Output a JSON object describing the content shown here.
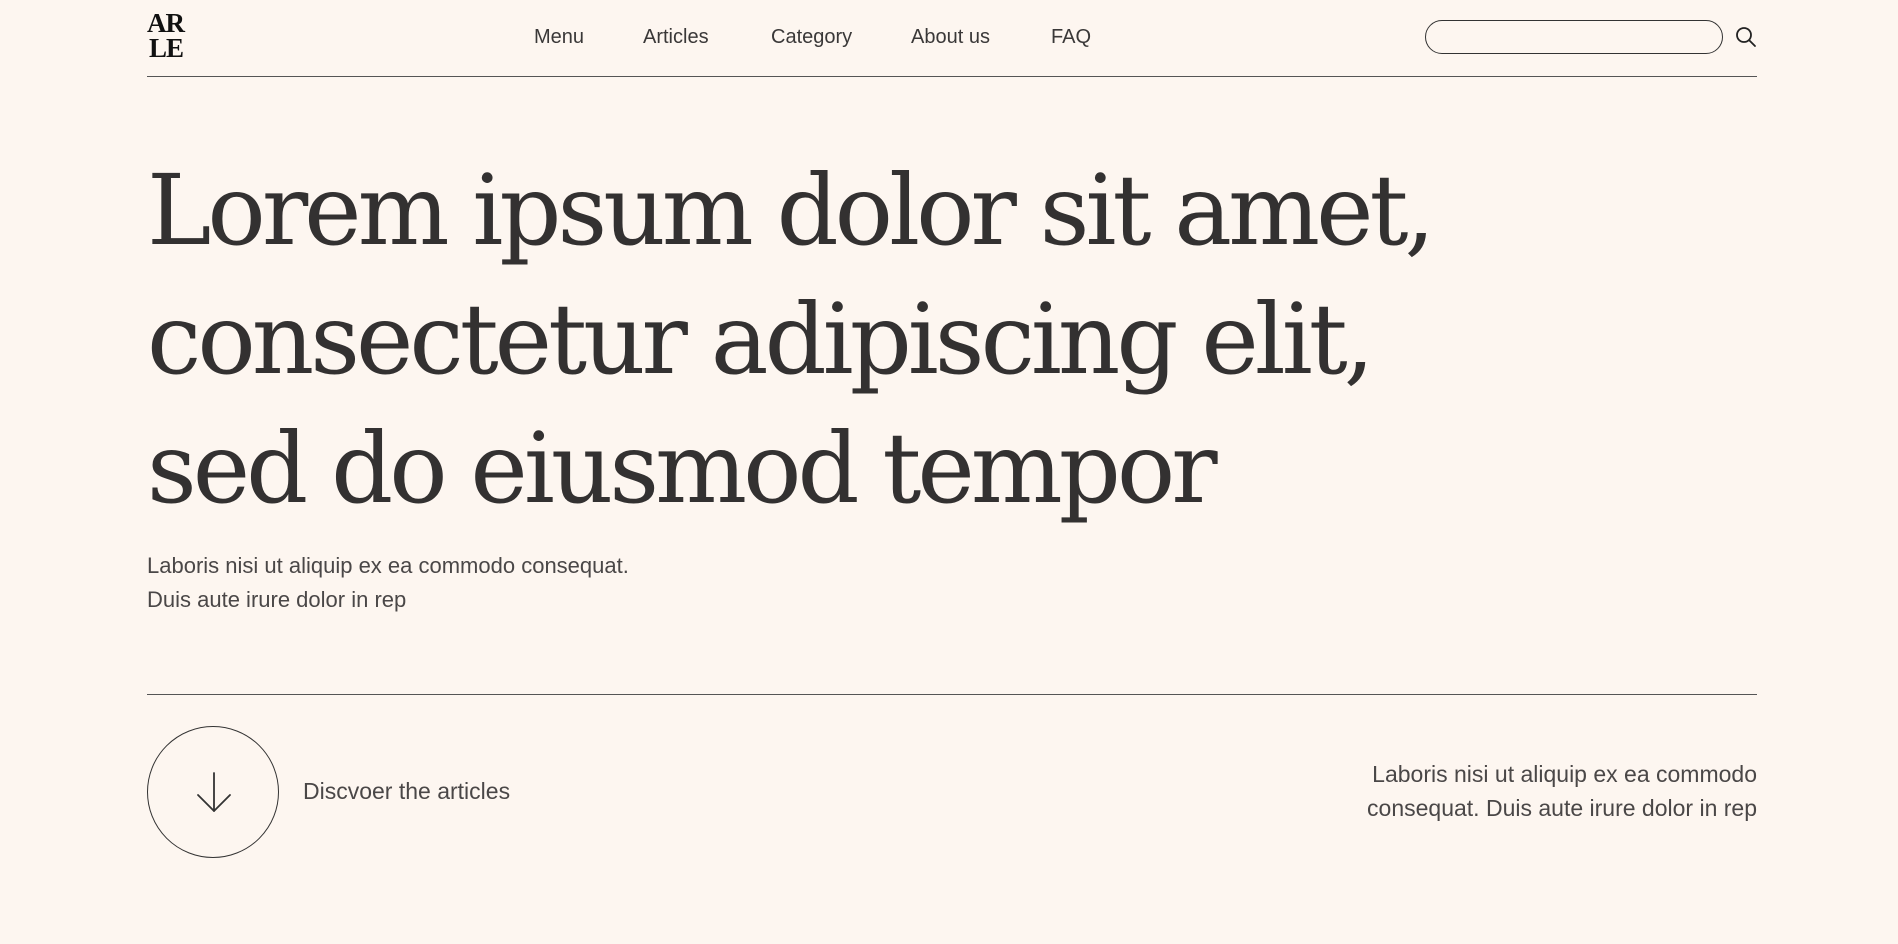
{
  "header": {
    "logo": {
      "line1": "AR",
      "line2": "LE"
    },
    "nav": [
      {
        "label": "Menu"
      },
      {
        "label": "Articles"
      },
      {
        "label": "Category"
      },
      {
        "label": "About us"
      },
      {
        "label": "FAQ"
      }
    ],
    "search": {
      "value": "",
      "placeholder": "",
      "icon": "search-icon"
    }
  },
  "hero": {
    "title_lines": [
      "Lorem ipsum dolor sit amet,",
      "consectetur adipiscing elit,",
      "sed do eiusmod tempor"
    ],
    "subtitle_lines": [
      "Laboris nisi ut aliquip ex ea commodo consequat.",
      "Duis aute irure dolor in rep"
    ]
  },
  "footer_row": {
    "discover": {
      "icon": "arrow-down-icon",
      "label": "Discvoer the articles"
    },
    "side_text_lines": [
      "Laboris nisi ut aliquip ex ea commodo",
      "consequat. Duis aute irure dolor in rep"
    ]
  },
  "colors": {
    "background": "#fdf6f0",
    "text": "#333131",
    "rule": "#555555"
  }
}
